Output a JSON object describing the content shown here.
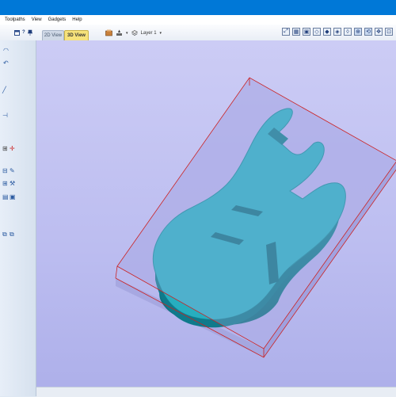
{
  "menu": {
    "items": [
      "Toolpaths",
      "View",
      "Gadgets",
      "Help"
    ]
  },
  "toolbar": {
    "help_glyph": "?",
    "tabs": {
      "view_2d": "2D View",
      "view_3d": "3D View"
    },
    "layer": "Layer 1"
  },
  "viewport": {
    "background_color": "#c4c5f3",
    "stock_color": "#a9abe6",
    "stock_outline_color": "#cc2222",
    "model_color": "#1fa3b5"
  }
}
